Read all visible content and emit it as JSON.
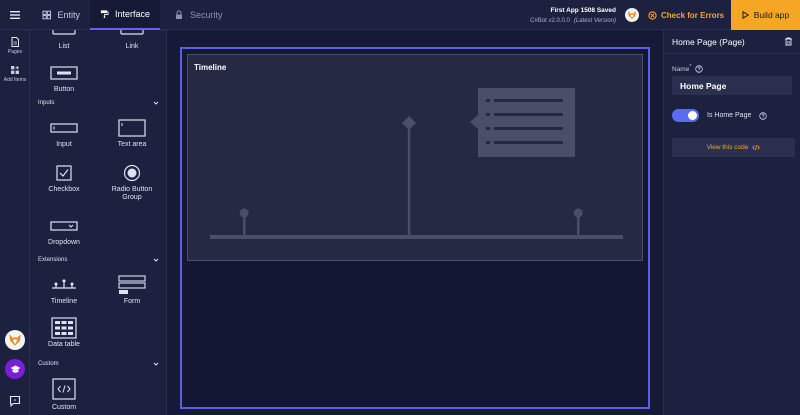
{
  "tabs": [
    {
      "label": "Entity"
    },
    {
      "label": "Interface"
    },
    {
      "label": "Security"
    }
  ],
  "app": {
    "name": "First App 1508 Saved",
    "version": "C#Bot v2.0.0.0",
    "version_note": "(Latest Version)"
  },
  "actions": {
    "check_errors": "Check for Errors",
    "build": "Build app"
  },
  "rail": {
    "pages": "Pages",
    "add_items": "Add Items"
  },
  "panel": {
    "top_items": [
      "List",
      "Link"
    ],
    "button": "Button",
    "sections": {
      "inputs": "Inputs",
      "extensions": "Extensions",
      "custom": "Custom"
    },
    "inputs": [
      "Input",
      "Text area",
      "Checkbox",
      "Radio Button Group",
      "Dropdown"
    ],
    "extensions": [
      "Timeline",
      "Form",
      "Data table"
    ],
    "custom": [
      "Custom"
    ]
  },
  "canvas": {
    "component_title": "Timeline"
  },
  "properties": {
    "title": "Home Page (Page)",
    "name_label": "Name",
    "required_mark": "*",
    "name_value": "Home Page",
    "is_home_label": "Is Home Page",
    "is_home": true,
    "view_code": "View this code"
  },
  "colors": {
    "accent": "#f5a623",
    "selection": "#5a5ee8",
    "toggle": "#5a6cf0",
    "background": "#161a36",
    "panel": "#1d2140"
  }
}
